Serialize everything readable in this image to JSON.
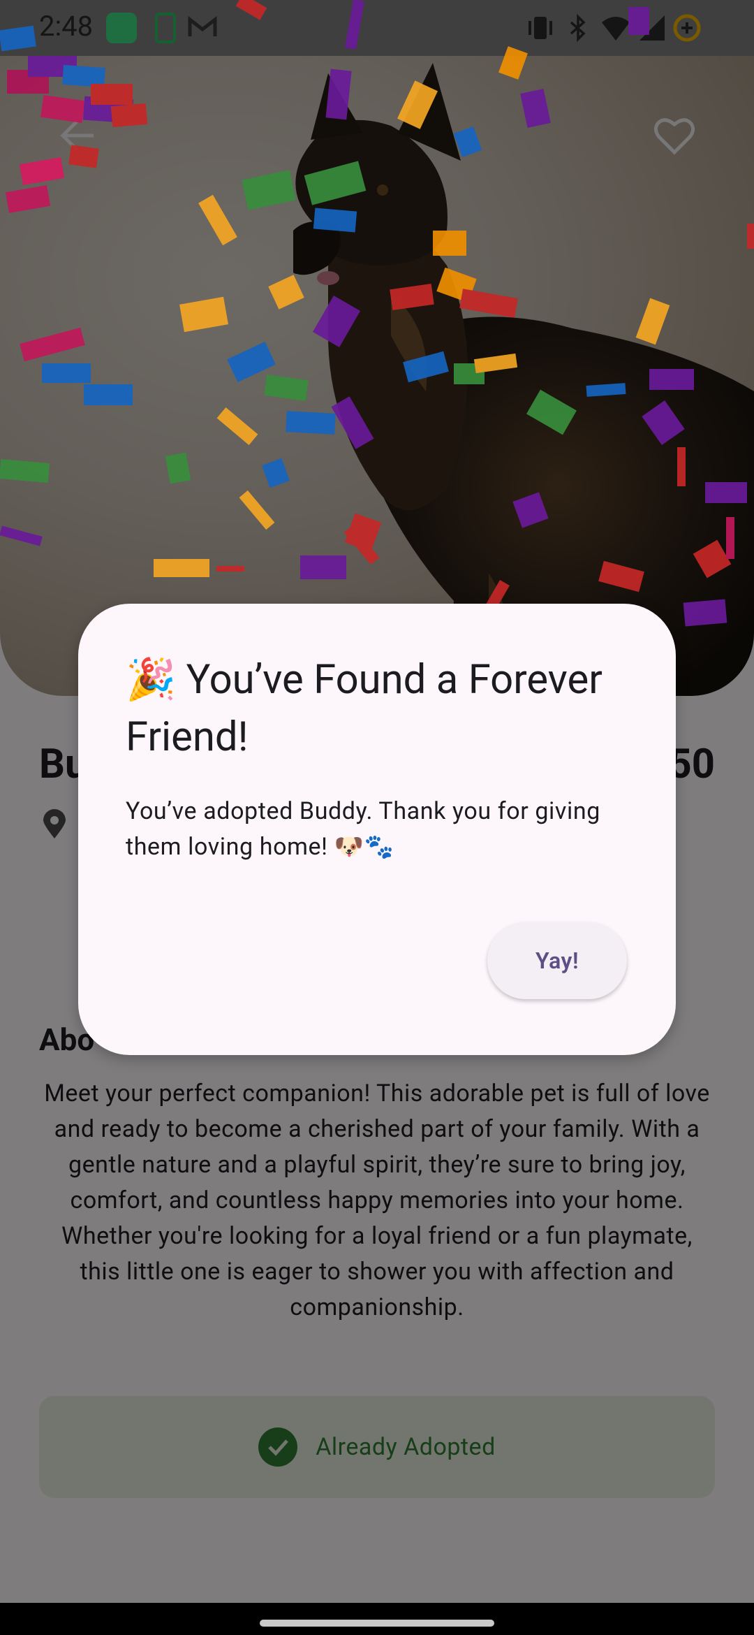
{
  "status_bar": {
    "time": "2:48",
    "left_icons": [
      "messages-icon",
      "battery-saver-icon",
      "gmail-icon"
    ],
    "right_icons": [
      "vibrate-icon",
      "bluetooth-icon",
      "wifi-icon",
      "signal-icon",
      "data-saver-icon"
    ]
  },
  "pet": {
    "name": "Buddy",
    "name_visible": "Bu",
    "price_visible": "50"
  },
  "about": {
    "title_visible": "Abo",
    "description": "Meet your perfect companion! This adorable pet is full of love and ready to become a cherished part of your family. With a gentle nature and a playful spirit, they’re sure to bring joy, comfort, and countless happy memories into your home. Whether you're looking for a loyal friend or a fun playmate, this little one is eager to shower you with affection and companionship."
  },
  "adoption_status": {
    "label": "Already Adopted",
    "color": "#2e7d32"
  },
  "dialog": {
    "title": "🎉 You’ve Found a Forever Friend!",
    "body": "You’ve adopted Buddy. Thank you for giving them loving home! 🐶🐾",
    "confirm_label": "Yay!"
  },
  "colors": {
    "accent": "#5a4f86",
    "dialog_bg": "#fdf7fc",
    "success": "#2e7d32"
  }
}
